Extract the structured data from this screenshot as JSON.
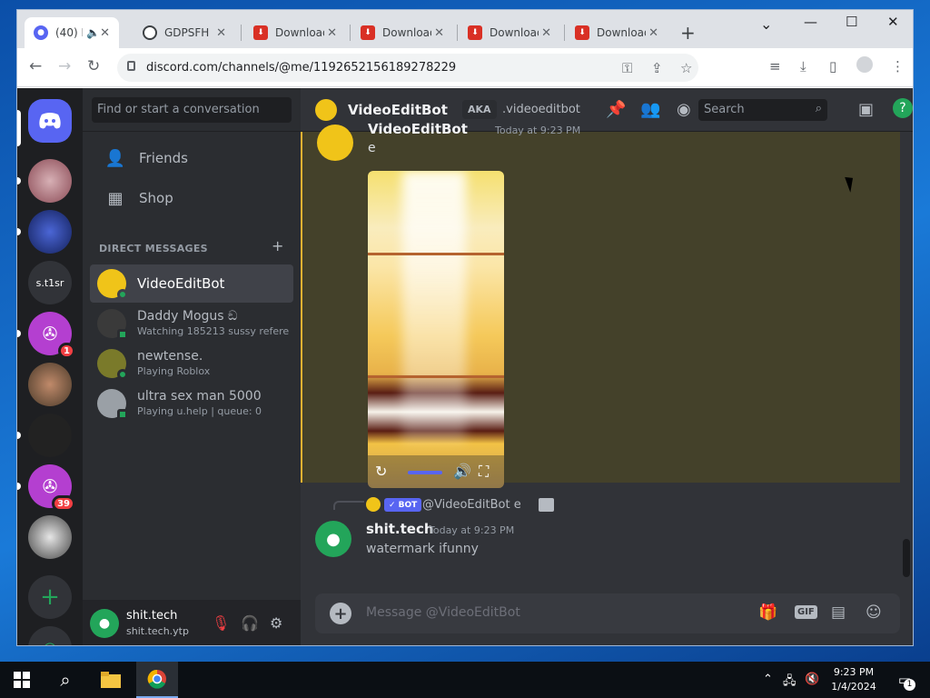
{
  "browser": {
    "tabs": [
      {
        "label": "(40) D",
        "badge": "40",
        "active": true
      },
      {
        "label": "GDPSFH",
        "active": false
      },
      {
        "label": "Download",
        "active": false
      },
      {
        "label": "Download",
        "active": false
      },
      {
        "label": "Download",
        "active": false
      },
      {
        "label": "Download",
        "active": false
      }
    ],
    "new_tab": "+",
    "url": "discord.com/channels/@me/1192652156189278229",
    "window_controls": {
      "dropdown": "⌄",
      "minimize": "—",
      "maximize": "☐",
      "close": "✕"
    }
  },
  "discord": {
    "guilds": [
      {
        "icon": "discord-home-icon",
        "label": "",
        "color": "#5865f2"
      },
      {
        "icon": "server-avatar",
        "label": "",
        "color": "#8a4a55"
      },
      {
        "icon": "server-avatar",
        "label": "",
        "color": "#233a8a"
      },
      {
        "icon": "server-text",
        "label": "s.t1sr",
        "color": "#313338"
      },
      {
        "icon": "server-avatar",
        "label": "",
        "color": "#b43fd0",
        "badge": "1"
      },
      {
        "icon": "server-avatar",
        "label": "",
        "color": "#6b4a3a"
      },
      {
        "icon": "server-avatar",
        "label": "",
        "color": "#222222"
      },
      {
        "icon": "server-avatar",
        "label": "",
        "color": "#b43fd0",
        "badge": "39"
      },
      {
        "icon": "server-avatar",
        "label": "",
        "color": "#555555"
      }
    ],
    "search_placeholder": "Find or start a conversation",
    "nav": {
      "friends": "Friends",
      "shop": "Shop"
    },
    "dm_section": "DIRECT MESSAGES",
    "dm_add": "+",
    "dms": [
      {
        "name": "VideoEditBot",
        "sub": "",
        "color": "#f0c419",
        "active": true
      },
      {
        "name": "Daddy Mogus ඞ",
        "sub": "Watching 185213 sussy refere...",
        "color": "#3a3a3a",
        "active": false
      },
      {
        "name": "newtense.",
        "sub": "Playing Roblox",
        "color": "#7a7a2a",
        "active": false
      },
      {
        "name": "ultra sex man 5000",
        "sub": "Playing u.help | queue: 0",
        "color": "#9aa0a6",
        "active": false
      }
    ],
    "user": {
      "name": "shit.tech",
      "tag": "shit.tech.ytp"
    },
    "chat_header": {
      "name": "VideoEditBot",
      "aka": "AKA",
      "aka_name": ".videoeditbot",
      "search_placeholder": "Search"
    },
    "message_top": {
      "author": "VideoEditBot",
      "time": "Today at 9:23 PM",
      "text": "e"
    },
    "reply": {
      "badge": "✓ BOT",
      "text": "@VideoEditBot e"
    },
    "message_bottom": {
      "author": "shit.tech",
      "time": "Today at 9:23 PM",
      "text": "watermark ifunny"
    },
    "composer_placeholder": "Message @VideoEditBot",
    "composer_icons": [
      "gift-icon",
      "gif-icon",
      "sticker-icon",
      "emoji-icon"
    ],
    "gif_label": "GIF"
  },
  "taskbar": {
    "time": "9:23 PM",
    "date": "1/4/2024",
    "notification_count": "1"
  }
}
